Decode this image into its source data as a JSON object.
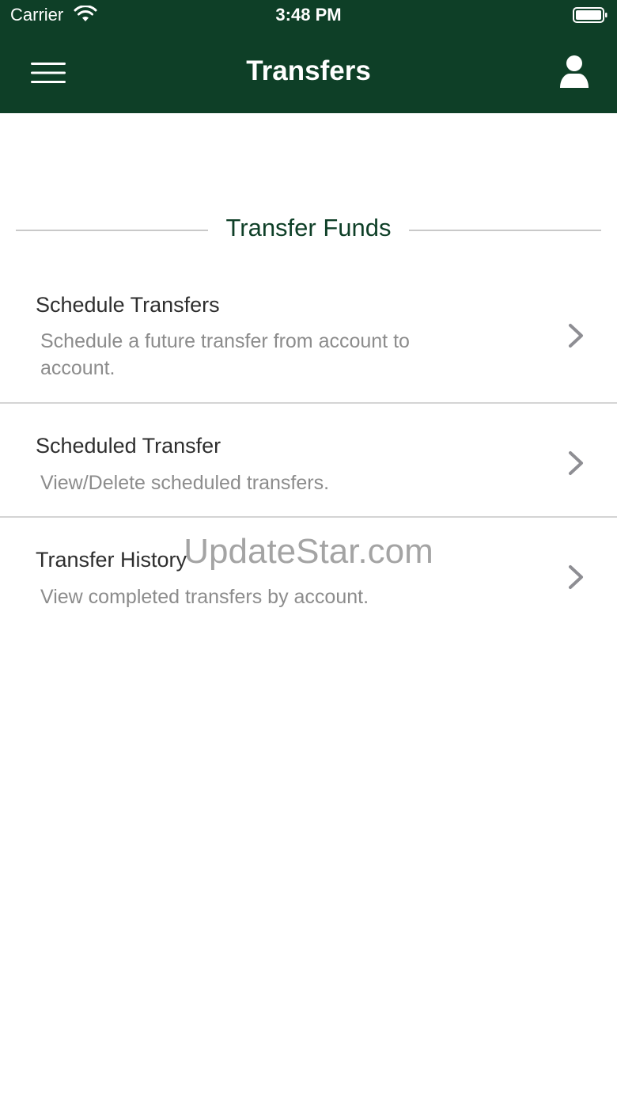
{
  "status_bar": {
    "carrier": "Carrier",
    "time": "3:48 PM"
  },
  "header": {
    "title": "Transfers",
    "menu_icon": "hamburger-menu-icon",
    "profile_icon": "user-icon",
    "background_color": "#0e3f27"
  },
  "section": {
    "title": "Transfer Funds",
    "accent_color": "#0e3f27"
  },
  "items": [
    {
      "title": "Schedule Transfers",
      "description": "Schedule a future transfer from account to account."
    },
    {
      "title": "Scheduled Transfer",
      "description": "View/Delete scheduled transfers."
    },
    {
      "title": "Transfer History",
      "description": "View completed transfers by account."
    }
  ],
  "watermark": "UpdateStar.com"
}
